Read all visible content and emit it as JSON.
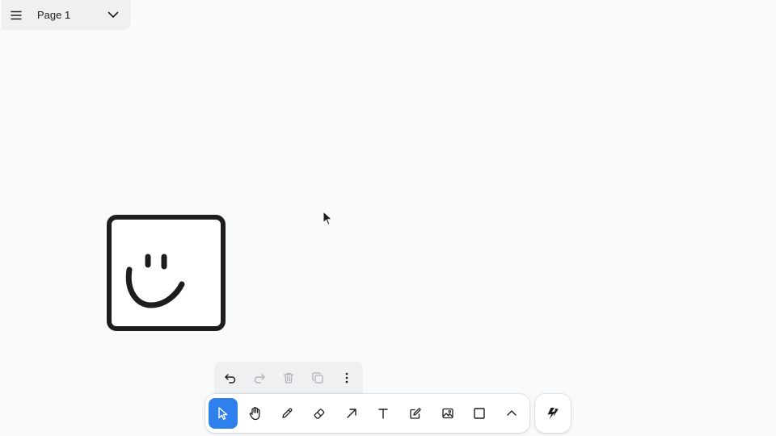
{
  "page_menu": {
    "current_page": "Page 1"
  },
  "icons": {
    "menu": "hamburger-menu-icon",
    "page_dropdown": "chevron-down-icon",
    "undo": "undo-icon",
    "redo": "redo-icon",
    "delete": "trash-icon",
    "duplicate": "duplicate-icon",
    "more": "more-vertical-icon",
    "select": "cursor-arrow-icon",
    "hand": "hand-icon",
    "draw": "pencil-icon",
    "eraser": "eraser-icon",
    "arrow": "arrow-icon",
    "text": "text-icon",
    "note": "note-icon",
    "asset": "image-icon",
    "rectangle": "rectangle-icon",
    "more_tools": "chevron-up-icon",
    "help": "tldraw-logo-icon"
  },
  "toolbar": {
    "active_tool": "select"
  },
  "colors": {
    "accent": "#2f80ed",
    "icon": "#1d1d1d",
    "icon_disabled": "#b0b3b8",
    "panel": "#eff0f2",
    "canvas": "#f9fafb"
  }
}
